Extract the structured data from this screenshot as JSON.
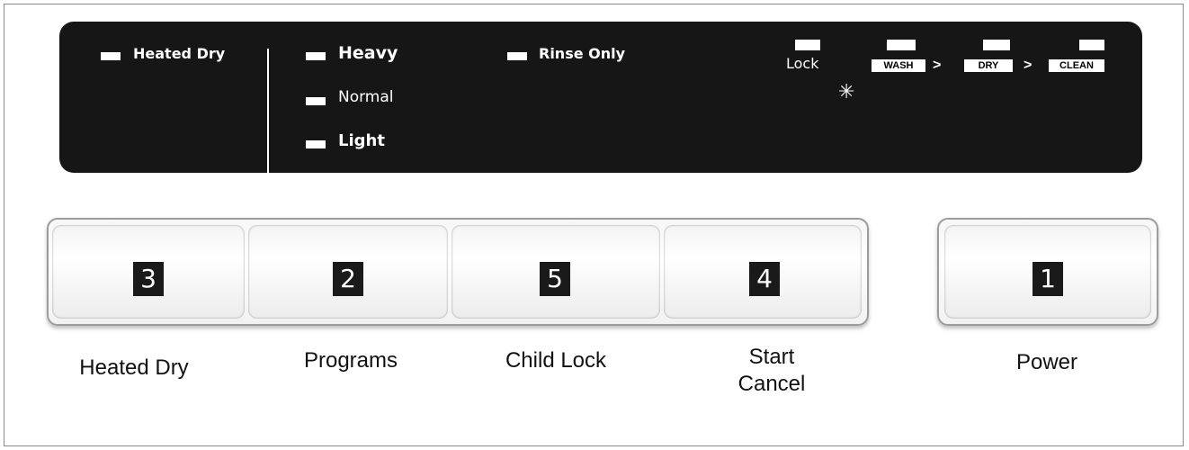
{
  "display": {
    "heated_dry": "Heated Dry",
    "heavy": "Heavy",
    "normal": "Normal",
    "light": "Light",
    "rinse_only": "Rinse Only",
    "lock": "Lock",
    "sanitized_icon": "✳",
    "stages": [
      "WASH",
      "DRY",
      "CLEAN"
    ],
    "arrow": ">"
  },
  "buttons": [
    {
      "number": "3",
      "label": "Heated Dry"
    },
    {
      "number": "2",
      "label": "Programs"
    },
    {
      "number": "5",
      "label": "Child Lock"
    },
    {
      "number": "4",
      "label_line1": "Start",
      "label_line2": "Cancel"
    },
    {
      "number": "1",
      "label": "Power"
    }
  ]
}
